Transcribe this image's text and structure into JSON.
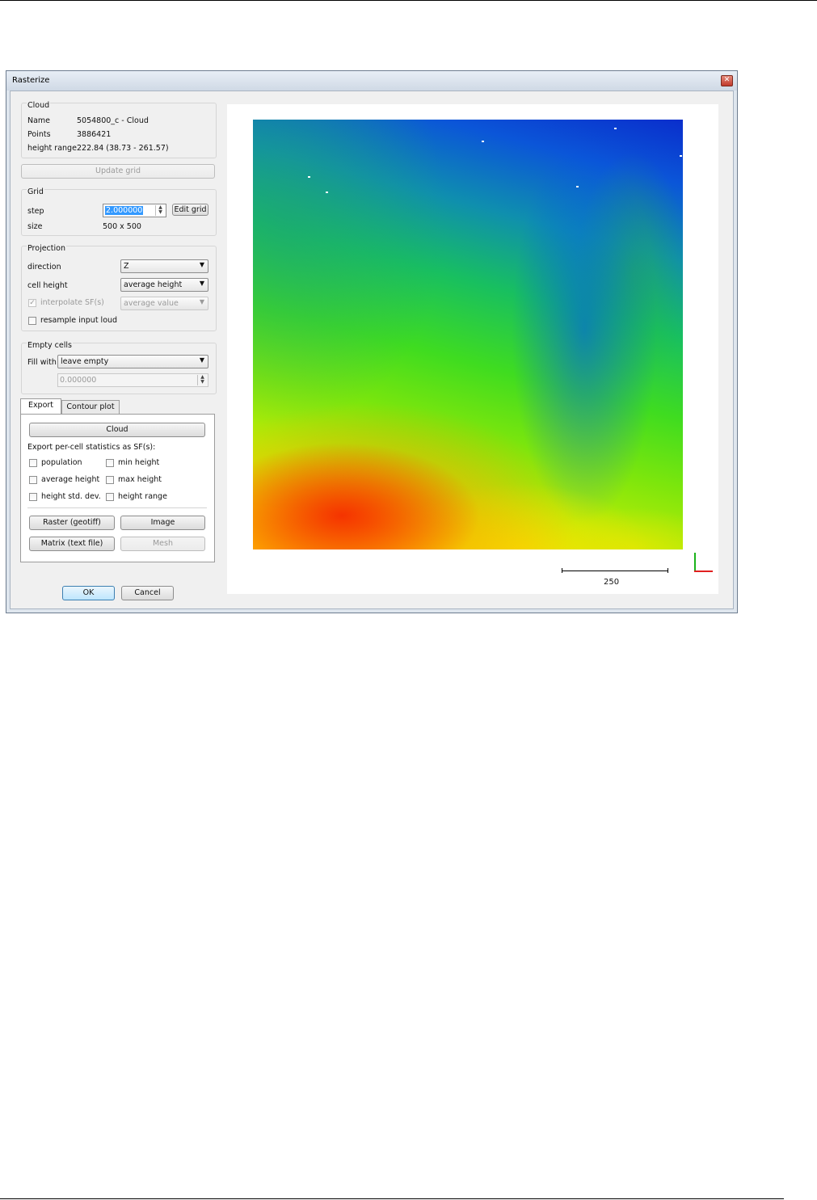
{
  "window": {
    "title": "Rasterize"
  },
  "cloud": {
    "group_title": "Cloud",
    "name_label": "Name",
    "name_value": "5054800_c - Cloud",
    "points_label": "Points",
    "points_value": "3886421",
    "range_label": "height range",
    "range_value": "222.84 (38.73 - 261.57)"
  },
  "update_grid_label": "Update grid",
  "grid": {
    "group_title": "Grid",
    "step_label": "step",
    "step_value": "2.000000",
    "edit_grid_label": "Edit grid",
    "size_label": "size",
    "size_value": "500 x 500"
  },
  "projection": {
    "group_title": "Projection",
    "direction_label": "direction",
    "direction_value": "Z",
    "cell_height_label": "cell height",
    "cell_height_value": "average height",
    "interpolate_label": "interpolate SF(s)",
    "interpolate_checked": true,
    "interpolate_value": "average value",
    "resample_label": "resample input loud",
    "resample_checked": false
  },
  "empty_cells": {
    "group_title": "Empty cells",
    "fill_label": "Fill with",
    "fill_value": "leave empty",
    "fill_number": "0.000000"
  },
  "tabs": {
    "export": "Export",
    "contour": "Contour plot",
    "active": "Export"
  },
  "export": {
    "cloud_button": "Cloud",
    "stats_caption": "Export per-cell statistics as SF(s):",
    "stats": {
      "population": "population",
      "min_height": "min height",
      "average_height": "average height",
      "max_height": "max height",
      "std_dev": "height std. dev.",
      "height_range": "height range"
    },
    "raster_button": "Raster (geotiff)",
    "image_button": "Image",
    "matrix_button": "Matrix (text file)",
    "mesh_button": "Mesh"
  },
  "dialog_buttons": {
    "ok": "OK",
    "cancel": "Cancel"
  },
  "preview": {
    "scale_label": "250"
  },
  "colors": {
    "x_axis": "#e02020",
    "y_axis": "#1bb31b",
    "default_button": "#3c7fb1"
  }
}
